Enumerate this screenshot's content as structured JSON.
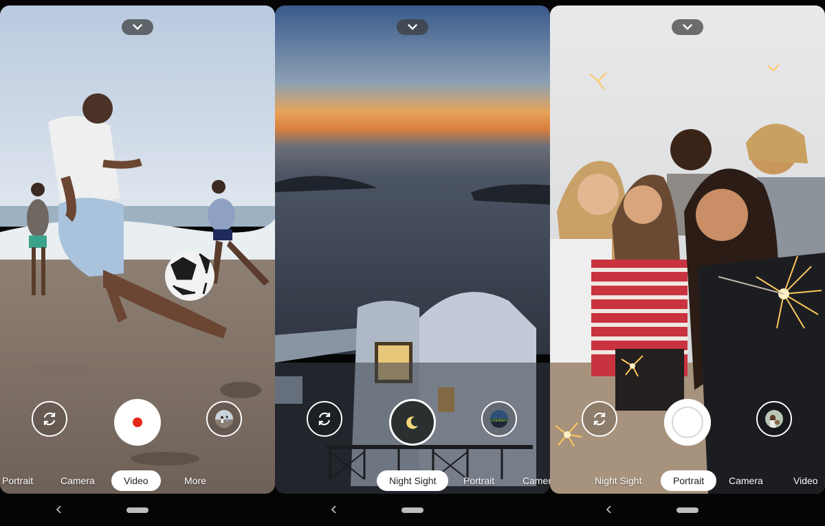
{
  "screens": [
    {
      "mode_tabs": [
        "Portrait",
        "Camera",
        "Video",
        "More"
      ],
      "active_mode": "Video",
      "shutter": "record-button"
    },
    {
      "mode_tabs": [
        "Night Sight",
        "Portrait",
        "Camera"
      ],
      "active_mode": "Night Sight",
      "shutter": "night-sight-shutter"
    },
    {
      "mode_tabs": [
        "Night Sight",
        "Portrait",
        "Camera",
        "Video"
      ],
      "active_mode": "Portrait",
      "shutter": "photo-shutter"
    }
  ],
  "colors": {
    "record_red": "#e8271b",
    "active_tab_bg": "#ffffff",
    "handle_bg": "#3c3c3c",
    "night_moon": "#f3d77a"
  },
  "icons": [
    "chevron-down-icon",
    "camera-switch-icon",
    "moon-icon",
    "back-icon",
    "home-pill"
  ]
}
